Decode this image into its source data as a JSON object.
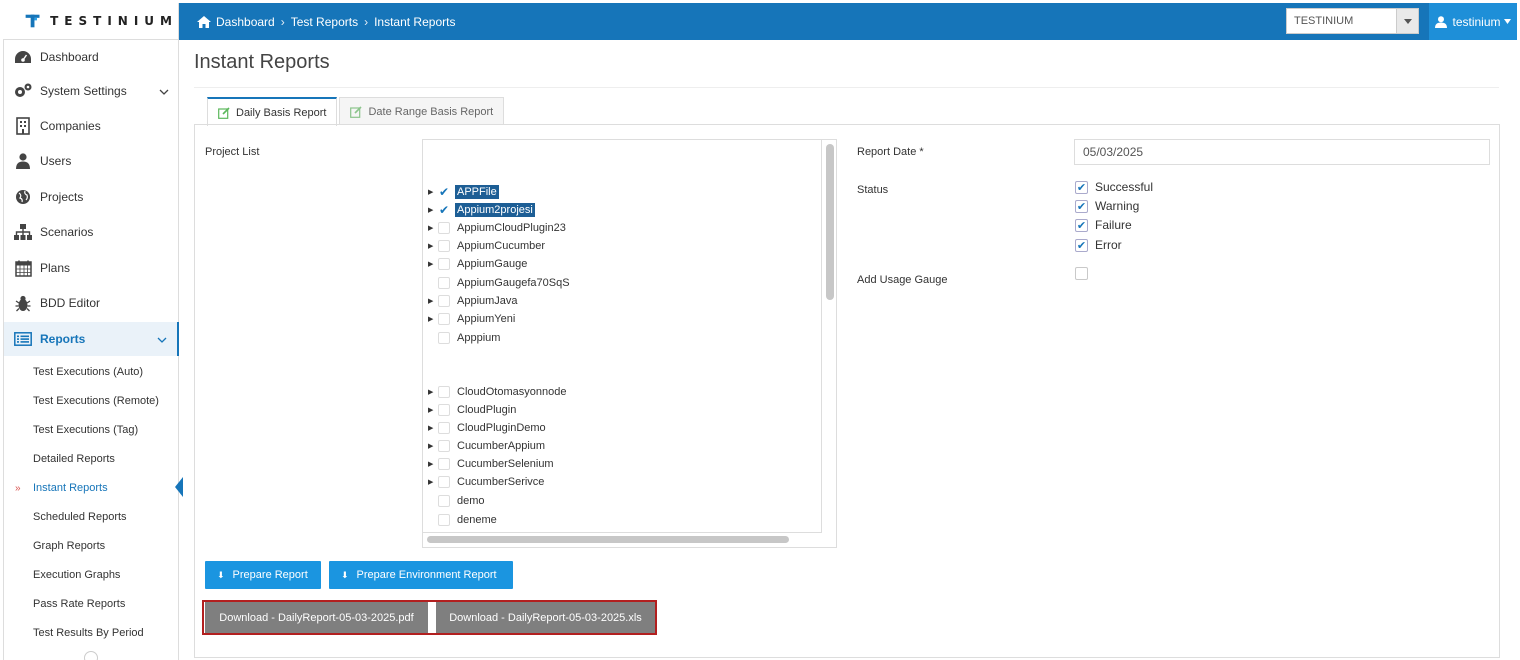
{
  "brand": {
    "name": "TESTINIUM",
    "accent": "#1675b9"
  },
  "header": {
    "breadcrumbs": [
      "Dashboard",
      "Test Reports",
      "Instant Reports"
    ],
    "org_select": "TESTINIUM",
    "user": "testinium"
  },
  "sidebar": {
    "items": [
      {
        "label": "Dashboard",
        "icon": "dashboard-icon"
      },
      {
        "label": "System Settings",
        "icon": "cogs-icon"
      },
      {
        "label": "Companies",
        "icon": "building-icon"
      },
      {
        "label": "Users",
        "icon": "user-icon"
      },
      {
        "label": "Projects",
        "icon": "globe-icon"
      },
      {
        "label": "Scenarios",
        "icon": "sitemap-icon"
      },
      {
        "label": "Plans",
        "icon": "calendar-icon"
      },
      {
        "label": "BDD Editor",
        "icon": "bug-icon"
      },
      {
        "label": "Reports",
        "icon": "list-icon"
      }
    ],
    "report_items": [
      "Test Executions (Auto)",
      "Test Executions (Remote)",
      "Test Executions (Tag)",
      "Detailed Reports",
      "Instant Reports",
      "Scheduled Reports",
      "Graph Reports",
      "Execution Graphs",
      "Pass Rate Reports",
      "Test Results By Period"
    ]
  },
  "page": {
    "title": "Instant Reports"
  },
  "tabs": [
    "Daily Basis Report",
    "Date Range Basis Report"
  ],
  "form": {
    "project_list_label": "Project List",
    "report_date_label": "Report Date *",
    "report_date_value": "05/03/2025",
    "status_label": "Status",
    "statuses": [
      "Successful",
      "Warning",
      "Failure",
      "Error"
    ],
    "usage_gauge_label": "Add Usage Gauge"
  },
  "projects": [
    {
      "name": "APPFile",
      "checked": true,
      "expandable": true
    },
    {
      "name": "Appium2projesi",
      "checked": true,
      "expandable": true
    },
    {
      "name": "AppiumCloudPlugin23",
      "checked": false,
      "expandable": true
    },
    {
      "name": "AppiumCucumber",
      "checked": false,
      "expandable": true
    },
    {
      "name": "AppiumGauge",
      "checked": false,
      "expandable": true
    },
    {
      "name": "AppiumGaugefa70SqS",
      "checked": false,
      "expandable": false
    },
    {
      "name": "AppiumJava",
      "checked": false,
      "expandable": true
    },
    {
      "name": "AppiumYeni",
      "checked": false,
      "expandable": true
    },
    {
      "name": "Apppium",
      "checked": false,
      "expandable": false
    },
    {
      "name": "CloudOtomasyonnode",
      "checked": false,
      "expandable": true
    },
    {
      "name": "CloudPlugin",
      "checked": false,
      "expandable": true
    },
    {
      "name": "CloudPluginDemo",
      "checked": false,
      "expandable": true
    },
    {
      "name": "CucumberAppium",
      "checked": false,
      "expandable": true
    },
    {
      "name": "CucumberSelenium",
      "checked": false,
      "expandable": true
    },
    {
      "name": "CucumberSerivce",
      "checked": false,
      "expandable": true
    },
    {
      "name": "demo",
      "checked": false,
      "expandable": false
    },
    {
      "name": "deneme",
      "checked": false,
      "expandable": false
    }
  ],
  "actions": {
    "prepare_report": "Prepare Report",
    "prepare_env_report": "Prepare Environment Report",
    "download_pdf": "Download - DailyReport-05-03-2025.pdf",
    "download_xls": "Download - DailyReport-05-03-2025.xls"
  }
}
